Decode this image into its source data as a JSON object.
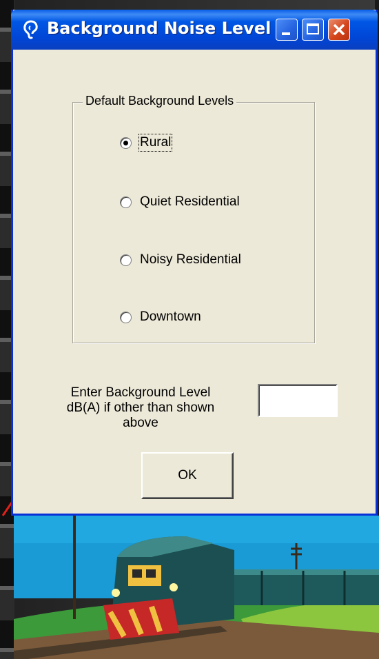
{
  "window": {
    "title": "Background Noise Level",
    "icon": "ear-icon",
    "controls": [
      "minimize-icon",
      "maximize-icon",
      "close-icon"
    ]
  },
  "group": {
    "legend": "Default Background Levels",
    "options": [
      {
        "label": "Rural",
        "selected": true
      },
      {
        "label": "Quiet Residential",
        "selected": false
      },
      {
        "label": "Noisy Residential",
        "selected": false
      },
      {
        "label": "Downtown",
        "selected": false
      }
    ]
  },
  "custom_level": {
    "label_line1": "Enter Background Level",
    "label_line2": "dB(A) if other than shown",
    "label_line3": "above",
    "value": ""
  },
  "ok_button": {
    "label": "OK"
  },
  "colors": {
    "titlebar": "#0046d6",
    "window_face": "#ece9d8",
    "close_button": "#d5451c",
    "arrow": "#e0201a"
  }
}
